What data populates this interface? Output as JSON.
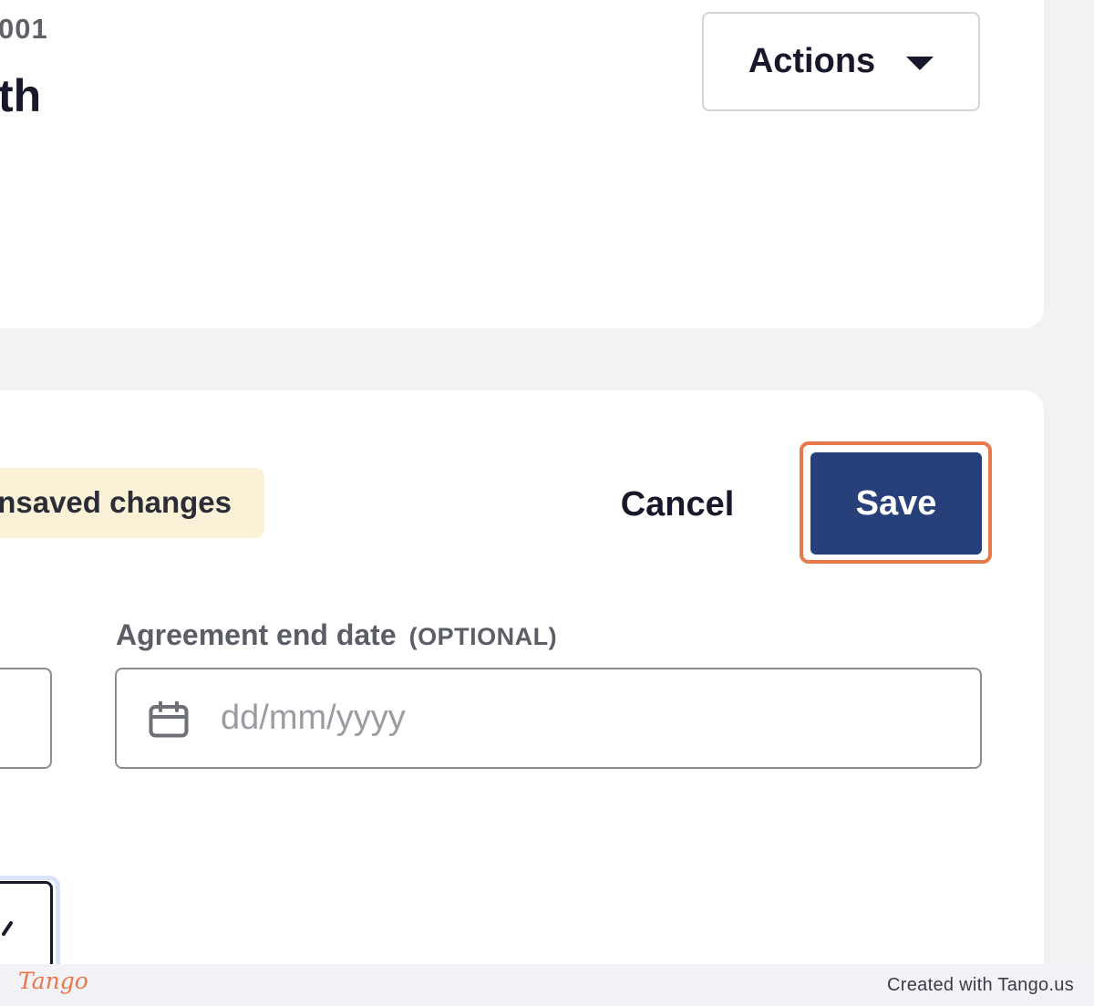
{
  "header": {
    "reference_number": "001",
    "title": "th",
    "actions_label": "Actions"
  },
  "edit_bar": {
    "unsaved_label": "Unsaved changes",
    "cancel_label": "Cancel",
    "save_label": "Save"
  },
  "agreement_end_date": {
    "label": "Agreement end date",
    "optional_tag": "(OPTIONAL)",
    "placeholder": "dd/mm/yyyy",
    "value": ""
  },
  "footer": {
    "logo_text": "Tango",
    "credit": "Created with Tango.us"
  },
  "colors": {
    "primary": "#28407a",
    "highlight": "#e8784a",
    "badge_bg": "#fbf1d6",
    "focus_ring": "#d9e4fb"
  },
  "icons": [
    "chevron-down-icon",
    "calendar-icon"
  ]
}
